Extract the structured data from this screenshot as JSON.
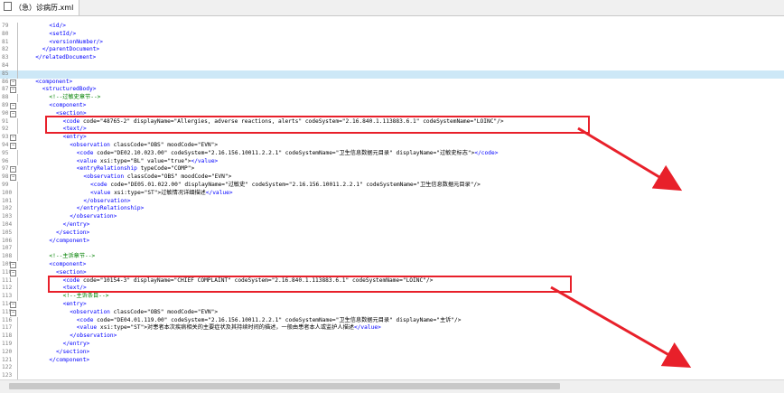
{
  "tab": {
    "title": "（急）诊病历.xml"
  },
  "lines": [
    {
      "n": "79",
      "fold": "",
      "code": "<id/>",
      "ind": 4
    },
    {
      "n": "80",
      "fold": "",
      "code": "<setId/>",
      "ind": 4
    },
    {
      "n": "81",
      "fold": "",
      "code": "<versionNumber/>",
      "ind": 4
    },
    {
      "n": "82",
      "fold": "",
      "code": "</parentDocument>",
      "ind": 3
    },
    {
      "n": "83",
      "fold": "",
      "code": "</relatedDocument>",
      "ind": 2
    },
    {
      "n": "84",
      "fold": "",
      "code": "",
      "ind": 0
    },
    {
      "n": "85",
      "fold": "",
      "code": "",
      "ind": 0,
      "hl": true
    },
    {
      "n": "86",
      "fold": "−",
      "code": "<component>",
      "ind": 2
    },
    {
      "n": "87",
      "fold": "−",
      "code": "<structuredBody>",
      "ind": 3
    },
    {
      "n": "88",
      "fold": "",
      "code": "<!--过敏史章节-->",
      "ind": 4,
      "cmt": true
    },
    {
      "n": "89",
      "fold": "−",
      "code": "<component>",
      "ind": 4
    },
    {
      "n": "90",
      "fold": "−",
      "code": "<section>",
      "ind": 5
    },
    {
      "n": "91",
      "fold": "",
      "code": "<code code=\"48765-2\" displayName=\"Allergies, adverse reactions, alerts\" codeSystem=\"2.16.840.1.113883.6.1\" codeSystemName=\"LOINC\"/>",
      "ind": 6
    },
    {
      "n": "92",
      "fold": "",
      "code": "<text/>",
      "ind": 6
    },
    {
      "n": "93",
      "fold": "−",
      "code": "<entry>",
      "ind": 6
    },
    {
      "n": "94",
      "fold": "−",
      "code": "<observation classCode=\"OBS\" moodCode=\"EVN\">",
      "ind": 7
    },
    {
      "n": "95",
      "fold": "",
      "code": "<code code=\"DE02.10.023.00\" codeSystem=\"2.16.156.10011.2.2.1\" codeSystemName=\"卫生信息数据元目录\" displayName=\"过敏史标志\"></code>",
      "ind": 8
    },
    {
      "n": "96",
      "fold": "",
      "code": "<value xsi:type=\"BL\" value=\"true\"></value>",
      "ind": 8
    },
    {
      "n": "97",
      "fold": "−",
      "code": "<entryRelationship typeCode=\"COMP\">",
      "ind": 8
    },
    {
      "n": "98",
      "fold": "−",
      "code": "<observation classCode=\"OBS\" moodCode=\"EVN\">",
      "ind": 9
    },
    {
      "n": "99",
      "fold": "",
      "code": "<code code=\"DE05.01.022.00\" displayName=\"过敏史\" codeSystem=\"2.16.156.10011.2.2.1\" codeSystemName=\"卫生信息数据元目录\"/>",
      "ind": 10
    },
    {
      "n": "100",
      "fold": "",
      "code": "<value xsi:type=\"ST\">过敏情况详细描述</value>",
      "ind": 10
    },
    {
      "n": "101",
      "fold": "",
      "code": "</observation>",
      "ind": 9
    },
    {
      "n": "102",
      "fold": "",
      "code": "</entryRelationship>",
      "ind": 8
    },
    {
      "n": "103",
      "fold": "",
      "code": "</observation>",
      "ind": 7
    },
    {
      "n": "104",
      "fold": "",
      "code": "</entry>",
      "ind": 6
    },
    {
      "n": "105",
      "fold": "",
      "code": "</section>",
      "ind": 5
    },
    {
      "n": "106",
      "fold": "",
      "code": "</component>",
      "ind": 4
    },
    {
      "n": "107",
      "fold": "",
      "code": "",
      "ind": 0
    },
    {
      "n": "108",
      "fold": "",
      "code": "<!--主诉章节-->",
      "ind": 4,
      "cmt": true
    },
    {
      "n": "109",
      "fold": "−",
      "code": "<component>",
      "ind": 4
    },
    {
      "n": "110",
      "fold": "−",
      "code": "<section>",
      "ind": 5
    },
    {
      "n": "111",
      "fold": "",
      "code": "<code code=\"10154-3\" displayName=\"CHIEF COMPLAINT\" codeSystem=\"2.16.840.1.113883.6.1\" codeSystemName=\"LOINC\"/>",
      "ind": 6
    },
    {
      "n": "112",
      "fold": "",
      "code": "<text/>",
      "ind": 6
    },
    {
      "n": "113",
      "fold": "",
      "code": "<!--主诉条目-->",
      "ind": 6,
      "cmt": true
    },
    {
      "n": "114",
      "fold": "−",
      "code": "<entry>",
      "ind": 6
    },
    {
      "n": "115",
      "fold": "−",
      "code": "<observation classCode=\"OBS\" moodCode=\"EVN\">",
      "ind": 7
    },
    {
      "n": "116",
      "fold": "",
      "code": "<code code=\"DE04.01.119.00\" codeSystem=\"2.16.156.10011.2.2.1\" codeSystemName=\"卫生信息数据元目录\" displayName=\"主诉\"/>",
      "ind": 8
    },
    {
      "n": "117",
      "fold": "",
      "code": "<value xsi:type=\"ST\">对患者本次疾病相关的主要症状及其持续时间的描述，一般由患者本人或监护人描述</value>",
      "ind": 8
    },
    {
      "n": "118",
      "fold": "",
      "code": "</observation>",
      "ind": 7
    },
    {
      "n": "119",
      "fold": "",
      "code": "</entry>",
      "ind": 6
    },
    {
      "n": "120",
      "fold": "",
      "code": "</section>",
      "ind": 5
    },
    {
      "n": "121",
      "fold": "",
      "code": "</component>",
      "ind": 4
    },
    {
      "n": "122",
      "fold": "",
      "code": "",
      "ind": 0
    },
    {
      "n": "123",
      "fold": "",
      "code": "",
      "ind": 0
    }
  ],
  "annotation_color": "#e8202a",
  "syntax_colors": {
    "tag": "#0000ff",
    "attr": "#000000",
    "value": "#ff0080",
    "comment": "#008000",
    "highlight": "#cde8f7"
  }
}
